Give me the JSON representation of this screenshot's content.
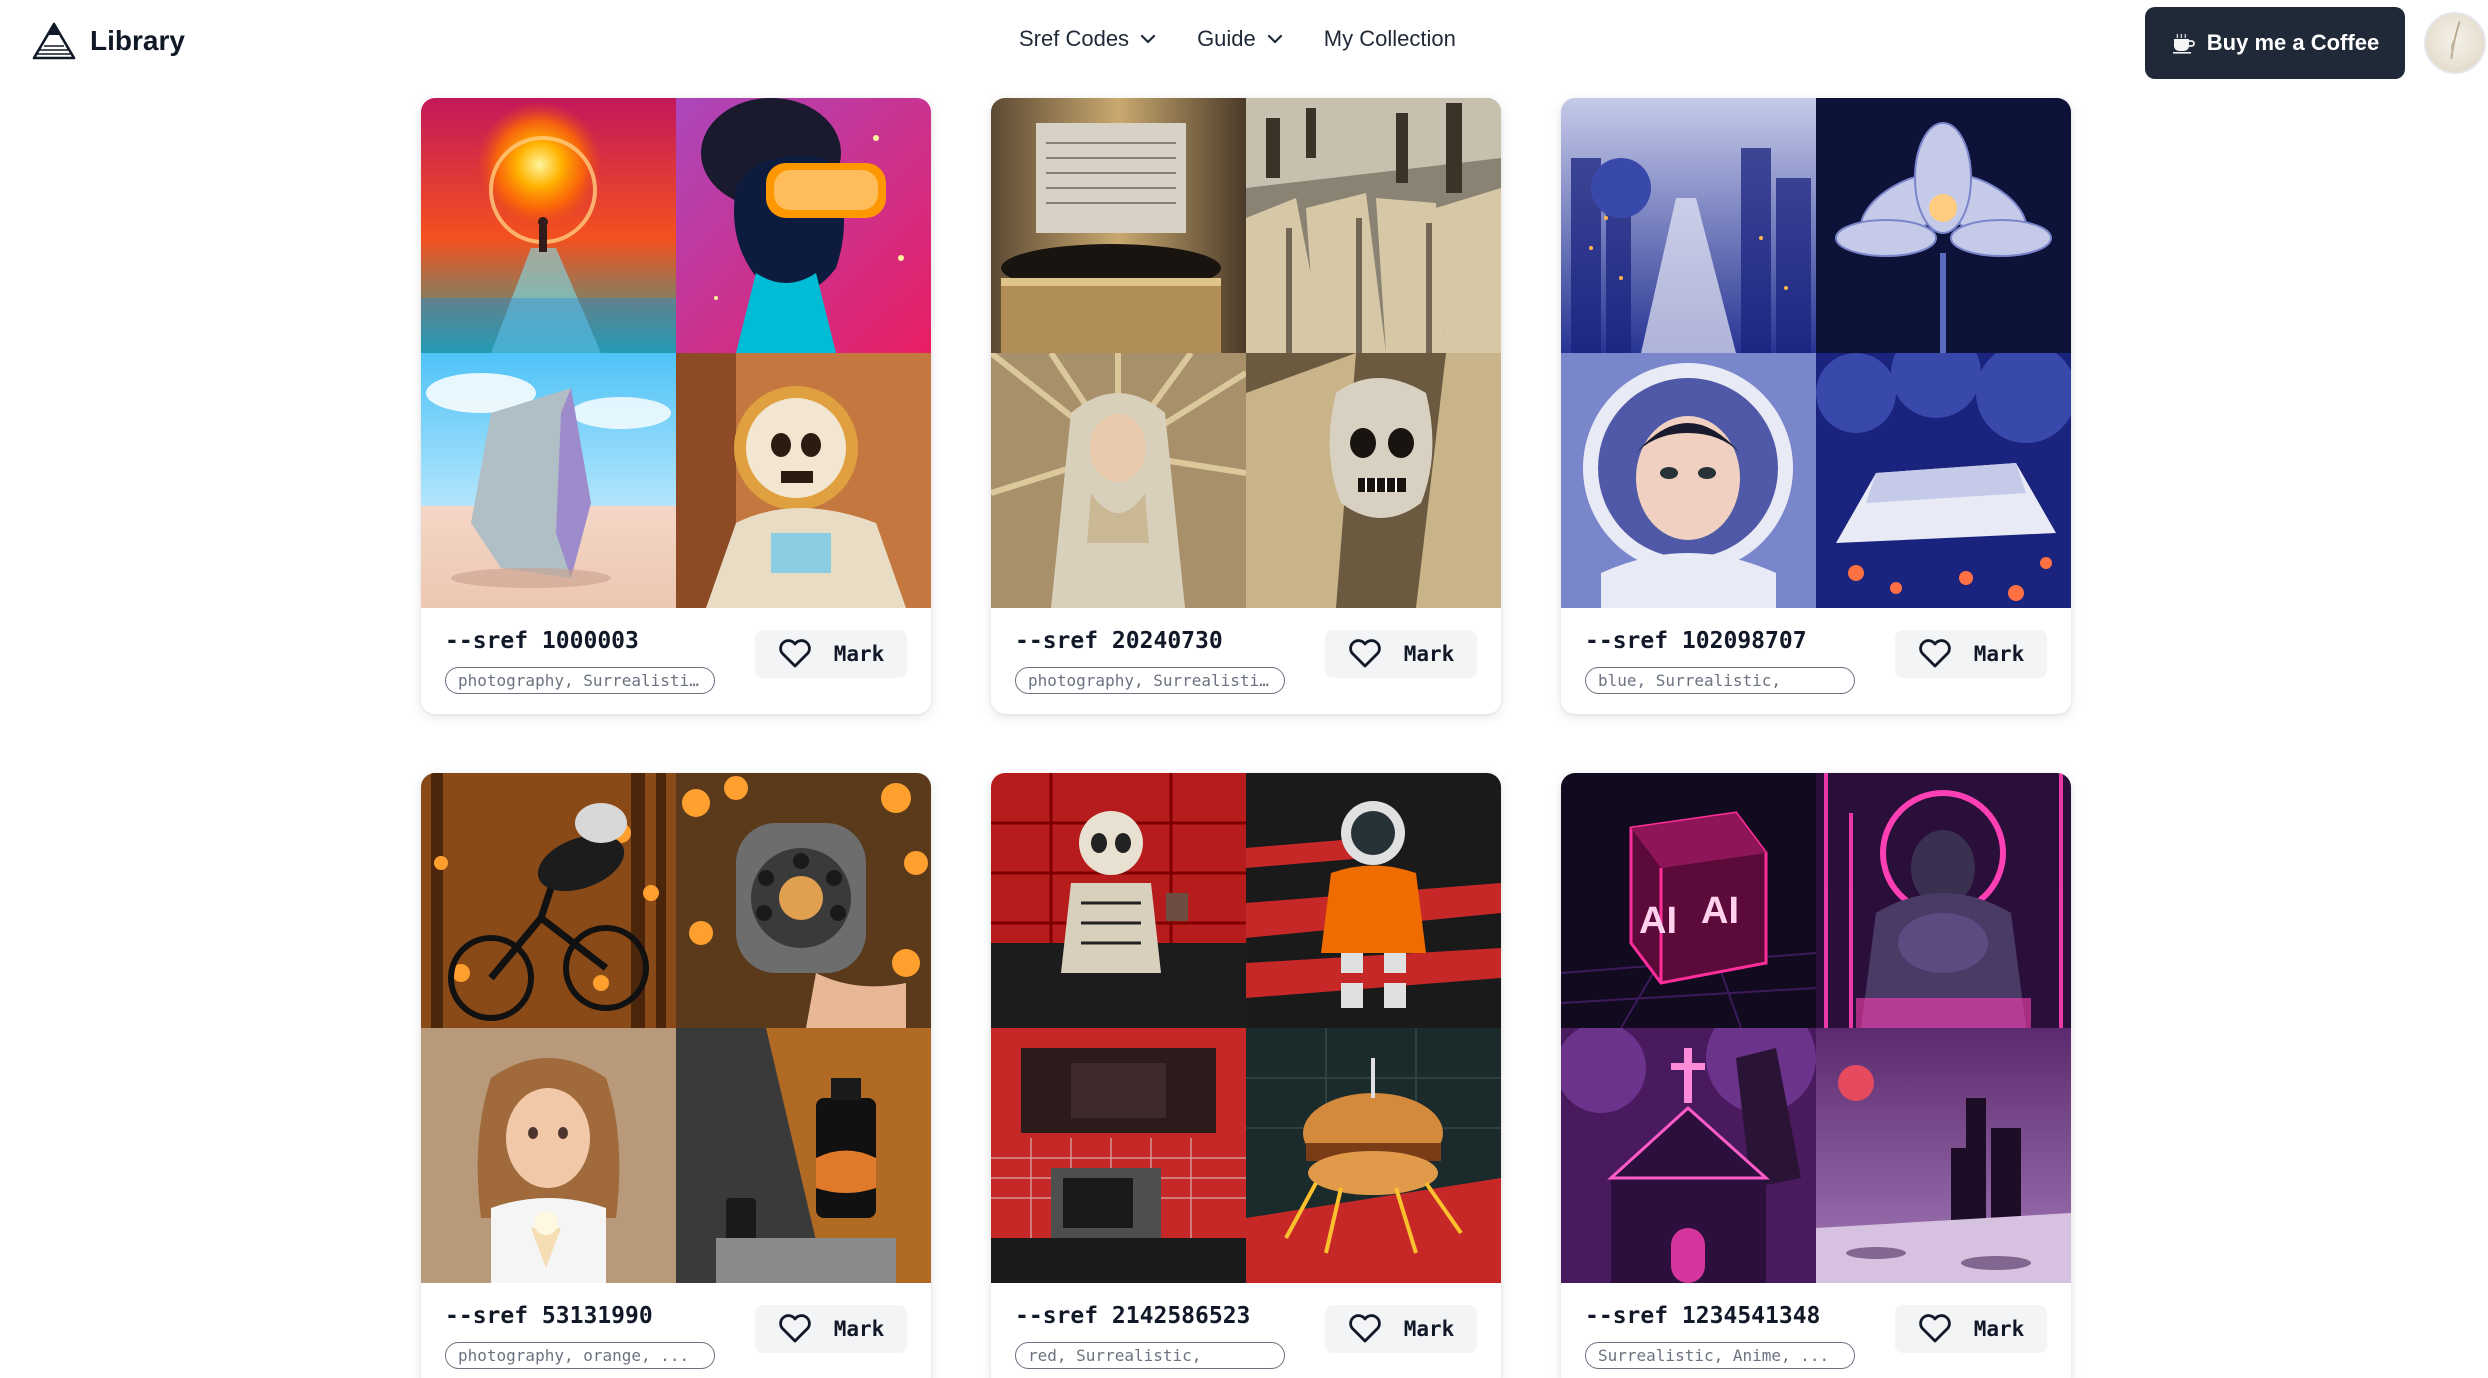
{
  "header": {
    "logo_text": "Library",
    "logo_icon": "mountain-triangle-icon",
    "nav": [
      {
        "label": "Sref Codes",
        "has_dropdown": true
      },
      {
        "label": "Guide",
        "has_dropdown": true
      },
      {
        "label": "My Collection",
        "has_dropdown": false
      }
    ],
    "coffee_button": "Buy me a Coffee",
    "coffee_icon": "coffee-cup-icon",
    "avatar_icon": "user-avatar"
  },
  "colors": {
    "primary_dark": "#1f2937",
    "button_light": "#f3f4f6",
    "tag_border": "#6b7280"
  },
  "cards": [
    {
      "code": "--sref 1000003",
      "tags": "photography, Surrealistic,",
      "mark_label": "Mark",
      "images": [
        "portal-walker",
        "vr-headset-woman",
        "desert-crystal-rock",
        "astronaut-skull"
      ]
    },
    {
      "code": "--sref 20240730",
      "tags": "photography, Surrealistic,",
      "mark_label": "Mark",
      "images": [
        "gold-record-player",
        "gold-city-crowd",
        "praying-madonna",
        "gold-skull"
      ]
    },
    {
      "code": "--sref 102098707",
      "tags": "blue, Surrealistic,",
      "mark_label": "Mark",
      "images": [
        "blue-futuristic-city",
        "crystal-lotus",
        "astronaut-girl",
        "blue-forest-bed"
      ]
    },
    {
      "code": "--sref 53131990",
      "tags": "photography, orange, ...",
      "mark_label": "Mark",
      "images": [
        "cyclist-autumn",
        "rotary-phone",
        "girl-ice-cream",
        "serum-bottle"
      ]
    },
    {
      "code": "--sref 2142586523",
      "tags": "red, Surrealistic,",
      "mark_label": "Mark",
      "images": [
        "skeleton-red-wall",
        "astronaut-red-stairs",
        "retro-kitchen",
        "burger-fries"
      ]
    },
    {
      "code": "--sref 1234541348",
      "tags": "Surrealistic, Anime, ...",
      "mark_label": "Mark",
      "images": [
        "neon-ai-cube",
        "neon-warrior",
        "neon-church",
        "pink-moon-landscape"
      ]
    }
  ]
}
